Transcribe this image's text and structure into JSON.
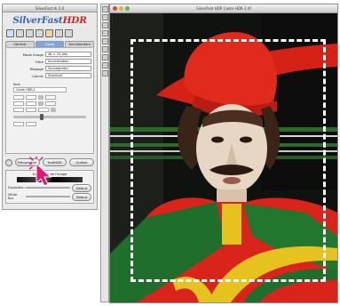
{
  "panel": {
    "title": "SilverFast Ai 2.0",
    "logo_main": "SilverFast",
    "logo_accent": "HDR",
    "tabs": [
      {
        "label": "Général"
      },
      {
        "label": "Cadre"
      },
      {
        "label": "Densitomètre"
      }
    ],
    "fields": [
      {
        "label": "Mode image",
        "value": "48 > 24 bits"
      },
      {
        "label": "Filtre",
        "value": "Accentuation"
      },
      {
        "label": "Réglage",
        "value": "Sauvegarder"
      },
      {
        "label": "Cannic",
        "value": "Standard"
      }
    ],
    "name_label": "Nom",
    "name_value": "Cadre HDR-1",
    "buttons": {
      "preview": "Prénuméris.",
      "scan": "TraitHDR",
      "quit": "Quitter"
    },
    "lower": {
      "heading": "Exposition de l'image",
      "rows": [
        {
          "label": "Exposition",
          "button": "Défaut"
        },
        {
          "label": "White Bal.",
          "button": "Défaut"
        }
      ]
    },
    "colors": {
      "logo": "#3c63b6",
      "logo_accent": "#c62828",
      "cursor": "#e3167a"
    }
  },
  "image_window": {
    "title": "SilverFast HDR Cadre HDR-1.tif",
    "image": "portrait-man-red-hat-white-makeup",
    "frame_color": "#ffffff"
  }
}
